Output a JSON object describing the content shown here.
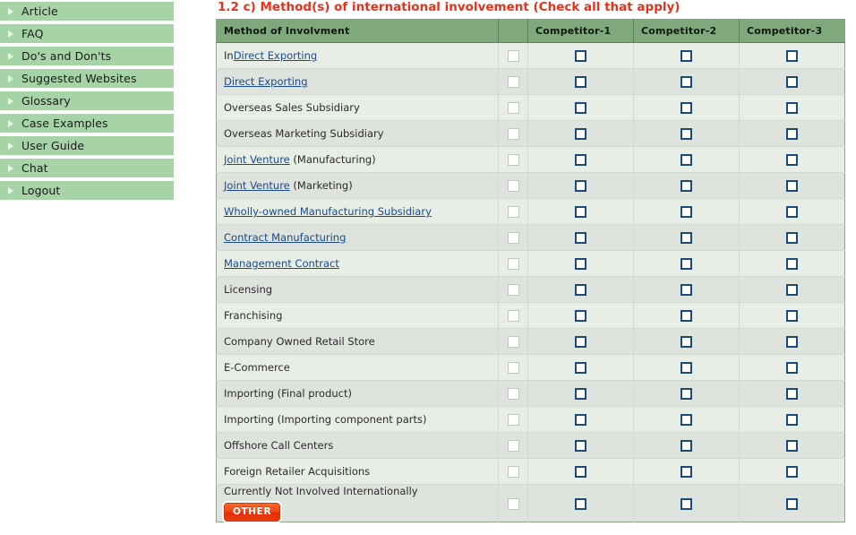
{
  "sidebar": {
    "items": [
      {
        "label": "Article",
        "icon": "triangle-right-icon"
      },
      {
        "label": "FAQ",
        "icon": "triangle-right-icon"
      },
      {
        "label": "Do's and Don'ts",
        "icon": "triangle-right-icon"
      },
      {
        "label": "Suggested Websites",
        "icon": "triangle-right-icon"
      },
      {
        "label": "Glossary",
        "icon": "triangle-right-icon"
      },
      {
        "label": "Case Examples",
        "icon": "triangle-right-icon"
      },
      {
        "label": "User Guide",
        "icon": "triangle-right-icon"
      },
      {
        "label": "Chat",
        "icon": "triangle-right-icon"
      },
      {
        "label": "Logout",
        "icon": "triangle-right-icon"
      }
    ]
  },
  "main": {
    "title": "1.2 c) Method(s) of international involvement (Check all that apply)",
    "other_button_label": "OTHER"
  },
  "table": {
    "headers": {
      "method": "Method of Involvment",
      "blank": "",
      "competitor_1": "Competitor-1",
      "competitor_2": "Competitor-2",
      "competitor_3": "Competitor-3"
    },
    "rows": [
      {
        "prefix": "In",
        "link": "Direct Exporting",
        "suffix": ""
      },
      {
        "prefix": "",
        "link": "Direct Exporting",
        "suffix": ""
      },
      {
        "prefix": "",
        "link": "",
        "plain": "Overseas Sales Subsidiary",
        "suffix": ""
      },
      {
        "prefix": "",
        "link": "",
        "plain": "Overseas Marketing Subsidiary",
        "suffix": ""
      },
      {
        "prefix": "",
        "link": "Joint Venture",
        "suffix": " (Manufacturing)"
      },
      {
        "prefix": "",
        "link": "Joint Venture",
        "suffix": " (Marketing)"
      },
      {
        "prefix": "",
        "link": "Wholly-owned Manufacturing Subsidiary",
        "suffix": ""
      },
      {
        "prefix": "",
        "link": "Contract Manufacturing",
        "suffix": ""
      },
      {
        "prefix": "",
        "link": "Management Contract",
        "suffix": ""
      },
      {
        "prefix": "",
        "link": "",
        "plain": "Licensing",
        "suffix": ""
      },
      {
        "prefix": "",
        "link": "",
        "plain": "Franchising",
        "suffix": ""
      },
      {
        "prefix": "",
        "link": "",
        "plain": "Company Owned Retail Store",
        "suffix": ""
      },
      {
        "prefix": "",
        "link": "",
        "plain": "E-Commerce",
        "suffix": ""
      },
      {
        "prefix": "",
        "link": "",
        "plain": "Importing (Final product)",
        "suffix": ""
      },
      {
        "prefix": "",
        "link": "",
        "plain": "Importing (Importing component parts)",
        "suffix": ""
      },
      {
        "prefix": "",
        "link": "",
        "plain": "Offshore Call Centers",
        "suffix": ""
      },
      {
        "prefix": "",
        "link": "",
        "plain": "Foreign Retailer Acquisitions",
        "suffix": ""
      },
      {
        "prefix": "",
        "link": "",
        "plain": "Currently Not Involved Internationally",
        "suffix": "",
        "has_other_button": true
      }
    ]
  },
  "colors": {
    "sidebar_bg": "#a7d4a7",
    "title_red": "#e8301a",
    "table_header_green": "#7fa97c",
    "row_odd": "#e8eee6",
    "row_even": "#dfe3dd",
    "link_blue": "#1a4a8a",
    "checkbox_blue_border": "#1b4a77",
    "checkbox_gray_border": "#c2c6c0",
    "other_button_orange": "#ee3b12"
  }
}
